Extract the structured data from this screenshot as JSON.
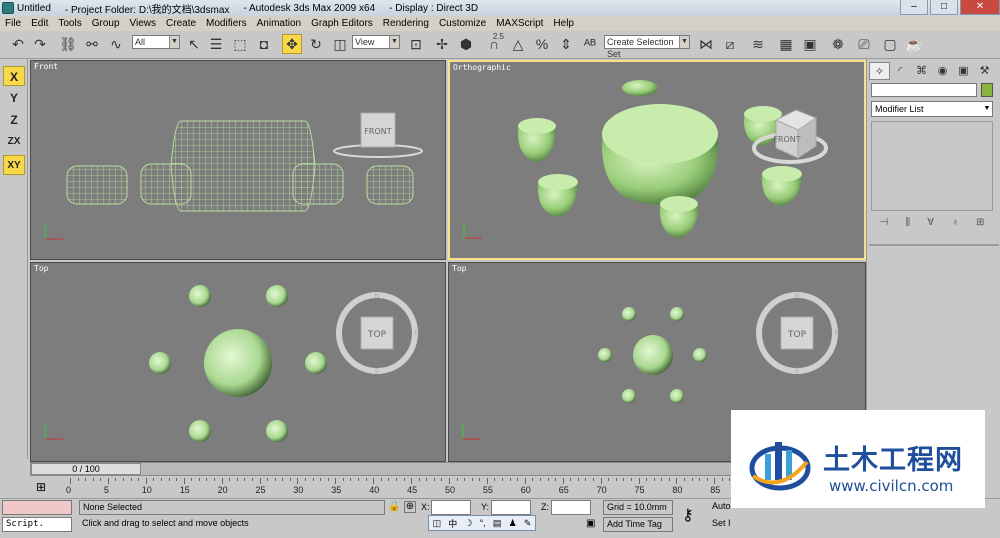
{
  "window": {
    "title_parts": [
      "Untitled",
      "- Project Folder: D:\\我的文档\\3dsmax",
      "- Autodesk 3ds Max  2009 x64",
      "- Display : Direct 3D"
    ]
  },
  "menu": [
    "File",
    "Edit",
    "Tools",
    "Group",
    "Views",
    "Create",
    "Modifiers",
    "Animation",
    "Graph Editors",
    "Rendering",
    "Customize",
    "MAXScript",
    "Help"
  ],
  "toolbar": {
    "selection_filter": "All",
    "ref_coord": "View",
    "snap_label": "2.5",
    "named_selection_placeholder": "Create Selection Set"
  },
  "axis_constraints": [
    "X",
    "Y",
    "Z",
    "ZX",
    "XY"
  ],
  "viewports": {
    "front": {
      "label": "Front",
      "cube_label": "FRONT"
    },
    "ortho": {
      "label": "Orthographic",
      "cube_label": "FRONT"
    },
    "top_left": {
      "label": "Top",
      "cube_label": "TOP",
      "compass": [
        "N",
        "S",
        "E"
      ]
    },
    "top_right": {
      "label": "Top",
      "cube_label": "TOP",
      "compass": [
        "N",
        "S",
        "E"
      ]
    }
  },
  "command_panel": {
    "modifier_list": "Modifier List"
  },
  "timeline": {
    "frame_readout": "0 / 100",
    "ruler_numbers": [
      0,
      5,
      10,
      15,
      20,
      25,
      30,
      35,
      40,
      45,
      50,
      55,
      60,
      65,
      70,
      75,
      80,
      85
    ]
  },
  "status": {
    "script_label": "Script.",
    "selection": "None Selected",
    "prompt": "Click and drag to select and move objects",
    "x_label": "X:",
    "y_label": "Y:",
    "z_label": "Z:",
    "grid": "Grid = 10.0mm",
    "add_time_tag": "Add Time Tag",
    "auto_key": "Auto",
    "set_key": "Set I"
  },
  "watermark": {
    "cn": "土木工程网",
    "url": "www.civilcn.com"
  },
  "colors": {
    "object_green": "#b8e0a0",
    "viewport_bg": "#7d7d7d",
    "active_border": "#f3e28a",
    "watermark_blue": "#1f4e9c"
  }
}
